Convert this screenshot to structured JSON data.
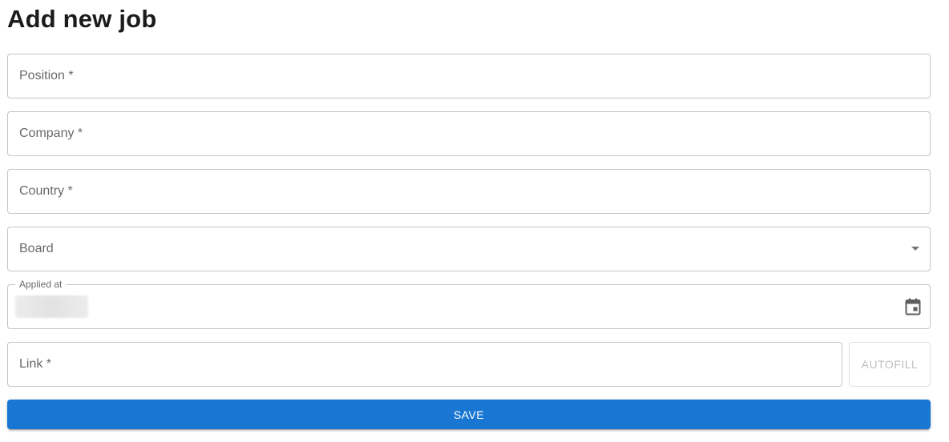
{
  "page": {
    "title": "Add new job"
  },
  "form": {
    "position": {
      "label": "Position *",
      "value": ""
    },
    "company": {
      "label": "Company *",
      "value": ""
    },
    "country": {
      "label": "Country *",
      "value": ""
    },
    "board": {
      "label": "Board",
      "value": "",
      "icon": "chevron-down-icon"
    },
    "applied_at": {
      "label": "Applied at",
      "value_redacted": true,
      "icon": "calendar-icon"
    },
    "link": {
      "label": "Link *",
      "value": ""
    },
    "autofill_label": "AUTOFILL",
    "save_label": "SAVE"
  },
  "colors": {
    "primary": "#1976d2",
    "border": "#c4c4c4",
    "disabled_text": "rgba(0,0,0,0.26)"
  }
}
